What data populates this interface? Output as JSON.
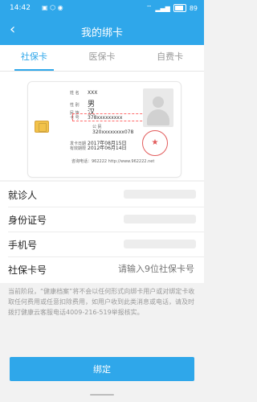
{
  "status_bar": {
    "time": "14:42",
    "battery_level": "89"
  },
  "header": {
    "title": "我的绑卡"
  },
  "tabs": [
    {
      "label": "社保卡"
    },
    {
      "label": "医保卡"
    },
    {
      "label": "自费卡"
    }
  ],
  "card": {
    "name_label": "姓  名",
    "name_value": "XXX",
    "gender_label": "性  别",
    "gender_value": "男",
    "ethnic_label": "民  族",
    "ethnic_value": "汉",
    "card_label": "卡  号",
    "card_value": "378xxxxxxxxx",
    "public_label": "公  民",
    "id_value": "320xxxxxxxx078",
    "issue_label": "发卡日期",
    "issue_value": "2017年08月15日",
    "valid_label": "有效期限",
    "valid_value": "2012年06月14日",
    "hotline": "咨询电话：962222 http://www.962222.net",
    "stamp_text": "社会保障局"
  },
  "form": {
    "rows": [
      {
        "label": "就诊人"
      },
      {
        "label": "身份证号"
      },
      {
        "label": "手机号"
      },
      {
        "label": "社保卡号",
        "placeholder": "请输入9位社保卡号"
      }
    ]
  },
  "notice": "当前阶段，“健康档案”将不会以任何形式向绑卡用户或对绑定卡收取任何费用或任意扣除费用，如用户收到此类消息或电话，请及时拨打健康云客服电话4009-216-519举报核实。",
  "actions": {
    "bind_label": "绑定"
  }
}
